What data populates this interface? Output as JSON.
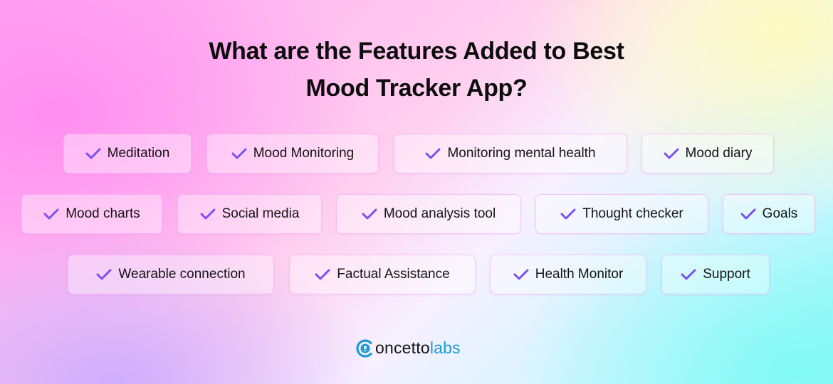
{
  "title": {
    "line1": "What are the Features Added to Best",
    "line2": "Mood Tracker App?"
  },
  "accent_color": "#7b4ff0",
  "features": [
    {
      "label": "Meditation",
      "icon": "check-icon"
    },
    {
      "label": "Mood Monitoring",
      "icon": "check-icon"
    },
    {
      "label": "Monitoring mental health",
      "icon": "check-icon"
    },
    {
      "label": "Mood diary",
      "icon": "check-icon"
    },
    {
      "label": "Mood charts",
      "icon": "check-icon"
    },
    {
      "label": "Social media",
      "icon": "check-icon"
    },
    {
      "label": "Mood analysis tool",
      "icon": "check-icon"
    },
    {
      "label": "Thought checker",
      "icon": "check-icon"
    },
    {
      "label": "Goals",
      "icon": "check-icon"
    },
    {
      "label": "Wearable connection",
      "icon": "check-icon"
    },
    {
      "label": "Factual Assistance",
      "icon": "check-icon"
    },
    {
      "label": "Health Monitor",
      "icon": "check-icon"
    },
    {
      "label": "Support",
      "icon": "check-icon"
    }
  ],
  "logo": {
    "part_dark": "oncetto",
    "part_blue": "labs",
    "icon": "lightbulb-c-icon",
    "brand_color": "#1e9ad6"
  }
}
